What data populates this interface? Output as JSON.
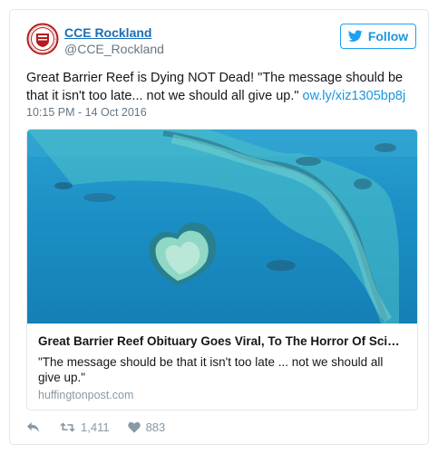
{
  "author": {
    "name": "CCE Rockland",
    "handle": "@CCE_Rockland"
  },
  "follow_label": "Follow",
  "tweet": {
    "text": "Great Barrier Reef is Dying NOT Dead! \"The message should be that it isn't too late... not we should all give up.\" ",
    "link": "ow.ly/xiz1305bp8j",
    "timestamp": "10:15 PM - 14 Oct 2016"
  },
  "card": {
    "title": "Great Barrier Reef Obituary Goes Viral, To The Horror Of Scientists",
    "description": "\"The message should be that it isn't too late ... not we should all give up.\"",
    "domain": "huffingtonpost.com"
  },
  "actions": {
    "retweets": "1,411",
    "likes": "883"
  },
  "colors": {
    "link": "#1b95e0",
    "follow_border": "#1da1f2",
    "muted": "#657786",
    "ocean": "#1a8fc7"
  },
  "icons": [
    "seal-logo-icon",
    "twitter-bird-icon",
    "reply-icon",
    "retweet-icon",
    "heart-icon"
  ]
}
